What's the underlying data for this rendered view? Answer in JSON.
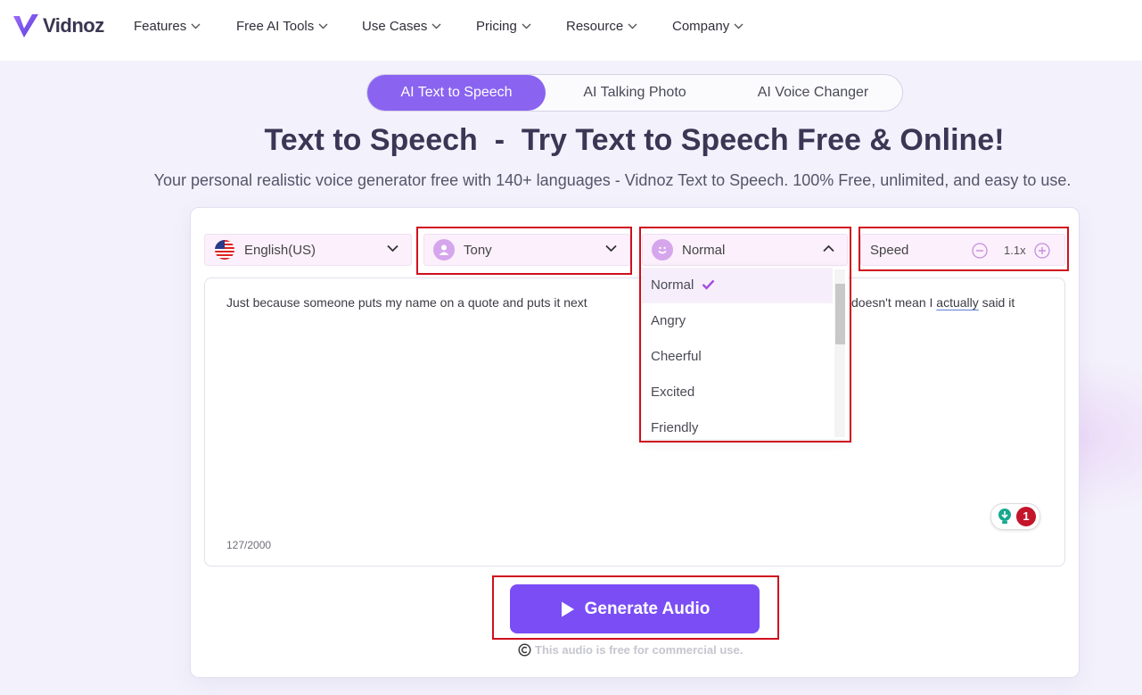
{
  "nav": {
    "brand": "Vidnoz",
    "items": [
      "Features",
      "Free AI Tools",
      "Use Cases",
      "Pricing",
      "Resource",
      "Company"
    ]
  },
  "tabs": [
    "AI Text to Speech",
    "AI Talking Photo",
    "AI Voice Changer"
  ],
  "hero": {
    "title": "Text to Speech  -  Try Text to Speech Free & Online!",
    "subtitle": "Your personal realistic voice generator free with 140+ languages - Vidnoz Text to Speech. 100% Free, unlimited, and easy to use."
  },
  "controls": {
    "language": "English(US)",
    "voice": "Tony",
    "emotion": "Normal",
    "speed_label": "Speed",
    "speed_value": "1.1x"
  },
  "emotion_options": [
    "Normal",
    "Angry",
    "Cheerful",
    "Excited",
    "Friendly"
  ],
  "editor": {
    "text_start": "Just because someone puts my name on a quote and puts it next",
    "text_end_a": "doesn't mean I ",
    "text_end_underlined": "actually",
    "text_end_b": " said it",
    "counter": "127/2000",
    "grammar_count": "1"
  },
  "generate": {
    "label": "Generate Audio",
    "note": "This audio is free for commercial use."
  },
  "colors": {
    "accent": "#7a4df5",
    "tab_active": "#8a63f0",
    "highlight": "#d0101e"
  }
}
